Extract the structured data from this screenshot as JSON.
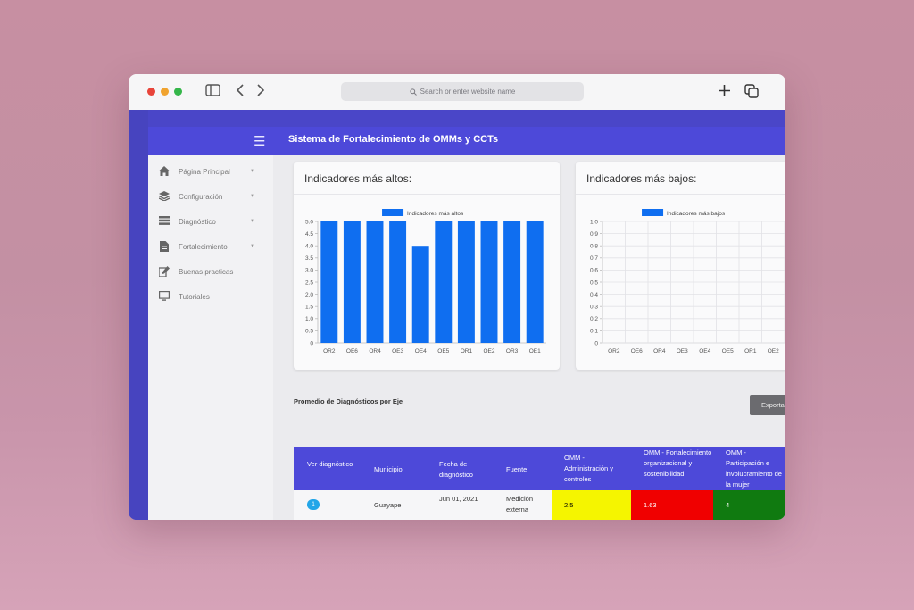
{
  "browser": {
    "address_placeholder": "Search or enter website name"
  },
  "app": {
    "title": "Sistema de Fortalecimiento de OMMs y CCTs"
  },
  "sidebar": {
    "items": [
      {
        "label": "Página Principal",
        "icon": "home-icon",
        "caret": true
      },
      {
        "label": "Configuración",
        "icon": "layers-icon",
        "caret": true
      },
      {
        "label": "Diagnóstico",
        "icon": "list-icon",
        "caret": true
      },
      {
        "label": "Fortalecimiento",
        "icon": "document-icon",
        "caret": true
      },
      {
        "label": "Buenas practicas",
        "icon": "edit-icon",
        "caret": false
      },
      {
        "label": "Tutoriales",
        "icon": "monitor-icon",
        "caret": false
      }
    ]
  },
  "cards": {
    "high_title": "Indicadores más altos:",
    "low_title": "Indicadores más bajos:"
  },
  "chart_data": [
    {
      "type": "bar",
      "title": "",
      "legend": "Indicadores más altos",
      "legend_position": "top",
      "categories": [
        "OR2",
        "OE6",
        "OR4",
        "OE3",
        "OE4",
        "OE5",
        "OR1",
        "OE2",
        "OR3",
        "OE1"
      ],
      "values": [
        5,
        5,
        5,
        5,
        4,
        5,
        5,
        5,
        5,
        5
      ],
      "ylim": [
        0,
        5
      ],
      "yticks": [
        "0",
        "0.5",
        "1.0",
        "1.5",
        "2.0",
        "2.5",
        "3.0",
        "3.5",
        "4.0",
        "4.5",
        "5.0"
      ],
      "color": "#0f6ef0",
      "grid": false
    },
    {
      "type": "bar",
      "title": "",
      "legend": "Indicadores más bajos",
      "legend_position": "top",
      "categories": [
        "OR2",
        "OE6",
        "OR4",
        "OE3",
        "OE4",
        "OE5",
        "OR1",
        "OE2"
      ],
      "values": [
        0,
        0,
        0,
        0,
        0,
        0,
        0,
        0
      ],
      "ylim": [
        0,
        1
      ],
      "yticks": [
        "0",
        "0.1",
        "0.2",
        "0.3",
        "0.4",
        "0.5",
        "0.6",
        "0.7",
        "0.8",
        "0.9",
        "1.0"
      ],
      "color": "#0f6ef0",
      "grid": true
    }
  ],
  "section": {
    "title": "Promedio de Diagnósticos por Eje",
    "export_label": "Exporta"
  },
  "table": {
    "headers": [
      "Ver diagnóstico",
      "Municipio",
      "Fecha de diagnóstico",
      "Fuente",
      "OMM - Administración y controles",
      "OMM - Fortalecimiento organizacional y sostenibilidad",
      "OMM - Participación e involucramiento de la mujer"
    ],
    "rows": [
      {
        "ver": "1",
        "municipio": "Guayape",
        "fecha": "Jun 01, 2021",
        "fuente": "Medición externa",
        "admin": "2.5",
        "fortalecimiento": "1.63",
        "participacion": "4",
        "colors": {
          "admin": "#f5f500",
          "fortalecimiento": "#f00000",
          "participacion": "#107a10"
        }
      }
    ]
  }
}
